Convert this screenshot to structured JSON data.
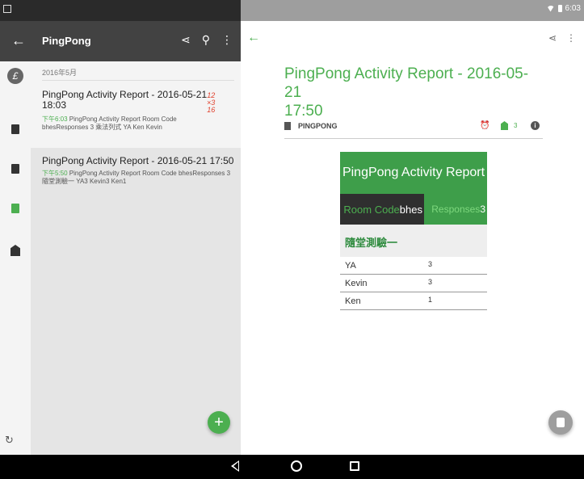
{
  "status_bar": {
    "time": "6:03"
  },
  "left_toolbar": {
    "title": "PingPong"
  },
  "list": {
    "month_header": "2016年5月",
    "items": [
      {
        "title_line1": "PingPong Activity Report - 2016-05-21",
        "title_line2": "18:03",
        "time": "下午6:03",
        "snippet_line1": " PingPong Activity Report Room Code",
        "snippet_line2": "bhesResponses 3 乘法列式 YA Ken Kevin",
        "handwriting": [
          "12",
          "×3",
          "16"
        ]
      },
      {
        "title_line1": "PingPong Activity Report - 2016-05-21 17:50",
        "time": "下午5:50",
        "snippet_line1": " PingPong Activity Report Room Code bhesResponses 3",
        "snippet_line2": "隨堂測驗一 YA3 Kevin3 Ken1"
      }
    ]
  },
  "fab": {
    "label": "+"
  },
  "document": {
    "title_line1": "PingPong Activity Report - 2016-05-21",
    "title_line2": "17:50",
    "notebook": "PINGPONG",
    "count": "3",
    "report": {
      "header": "PingPong Activity Report",
      "room_code_label": "Room Code ",
      "room_code": "bhes",
      "responses_label": "Responses ",
      "responses": "3",
      "quiz_title": "隨堂測驗一",
      "scores": [
        {
          "name": "YA",
          "value": "3"
        },
        {
          "name": "Kevin",
          "value": "3"
        },
        {
          "name": "Ken",
          "value": "1"
        }
      ]
    }
  },
  "colors": {
    "accent": "#4caf50",
    "toolbar": "#424242",
    "report_green": "#3e9e4a"
  }
}
